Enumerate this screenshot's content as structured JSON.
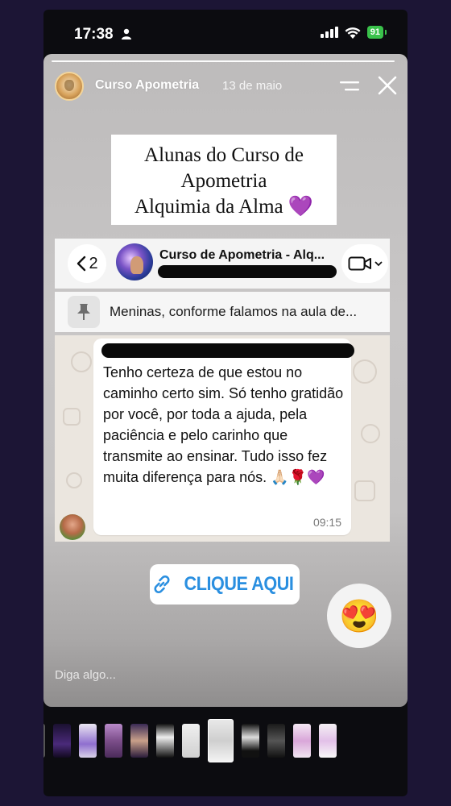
{
  "status_bar": {
    "time": "17:38",
    "battery": "91"
  },
  "story": {
    "username": "Curso Apometria",
    "date": "13 de maio",
    "title_lines": [
      "Alunas do Curso de",
      "Apometria",
      "Alquimia da Alma 💜"
    ],
    "reply_placeholder": "Diga algo..."
  },
  "chat": {
    "back_count": "2",
    "group_name": "Curso de Apometria - Alq...",
    "pinned_text": "Meninas, conforme falamos na aula de...",
    "message": "Tenho certeza de que estou no caminho certo sim. Só tenho gratidão por você, por toda a ajuda, pela paciência e pelo carinho que transmite ao ensinar. Tudo isso fez muita diferença para nós. 🙏🏻🌹💜",
    "message_time": "09:15"
  },
  "link_sticker": {
    "label": "CLIQUE AQUI"
  },
  "reaction": {
    "emoji": "😍"
  },
  "colors": {
    "link_blue": "#2a8fe0",
    "battery_green": "#3ac24b",
    "background": "#1c1535"
  },
  "thumbnails": [
    {
      "kind": "dark-purple"
    },
    {
      "kind": "screenshot-purple"
    },
    {
      "kind": "photo-woman"
    },
    {
      "kind": "photo-woman-dark"
    },
    {
      "kind": "chat-dark"
    },
    {
      "kind": "chat-light"
    },
    {
      "kind": "chat-active"
    },
    {
      "kind": "chat-dark"
    },
    {
      "kind": "chat-dark"
    },
    {
      "kind": "pink-card"
    },
    {
      "kind": "pink-card"
    }
  ]
}
